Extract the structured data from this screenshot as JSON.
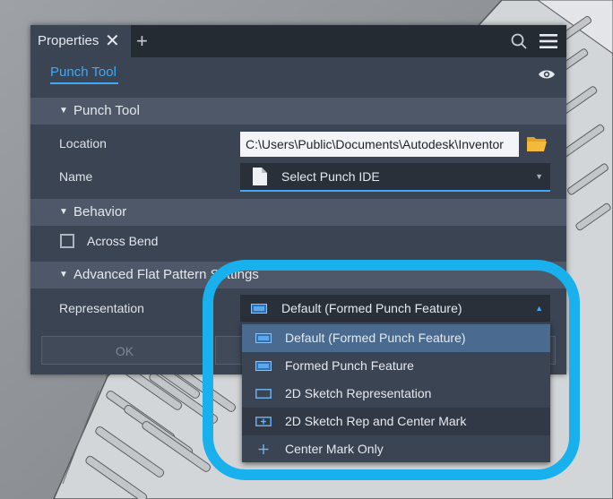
{
  "window": {
    "tab_title": "Properties",
    "close_glyph": "✕",
    "add_glyph": "+",
    "icons": [
      "search-icon",
      "hamburger-menu-icon"
    ]
  },
  "subtab": {
    "label": "Punch Tool",
    "icon": "eye-icon"
  },
  "sections": {
    "punch_tool": {
      "title": "Punch Tool",
      "expanded": true
    },
    "behavior": {
      "title": "Behavior",
      "expanded": true
    },
    "advanced": {
      "title": "Advanced Flat Pattern Settings",
      "expanded": true
    }
  },
  "fields": {
    "location": {
      "label": "Location",
      "value": "C:\\Users\\Public\\Documents\\Autodesk\\Inventor",
      "icon": "folder-icon"
    },
    "name": {
      "label": "Name",
      "value": "Select Punch IDE",
      "icon": "document-icon"
    },
    "across_bend": {
      "label": "Across Bend",
      "checked": false
    },
    "representation": {
      "label": "Representation",
      "value": "Default (Formed Punch Feature)",
      "open": true
    }
  },
  "buttons": {
    "ok": "OK"
  },
  "representation_options": [
    {
      "label": "Default (Formed Punch Feature)",
      "icon": "formed-feature-icon",
      "selected": true
    },
    {
      "label": "Formed Punch Feature",
      "icon": "formed-feature-icon",
      "selected": false
    },
    {
      "label": "2D Sketch Representation",
      "icon": "sketch-rectangle-icon",
      "selected": false
    },
    {
      "label": "2D Sketch Rep and Center Mark",
      "icon": "sketch-center-mark-icon",
      "selected": false
    },
    {
      "label": "Center Mark Only",
      "icon": "center-mark-icon",
      "selected": false
    }
  ],
  "colors": {
    "accent": "#3fa9f5",
    "callout": "#19b0ee",
    "panel": "#3b4453"
  }
}
